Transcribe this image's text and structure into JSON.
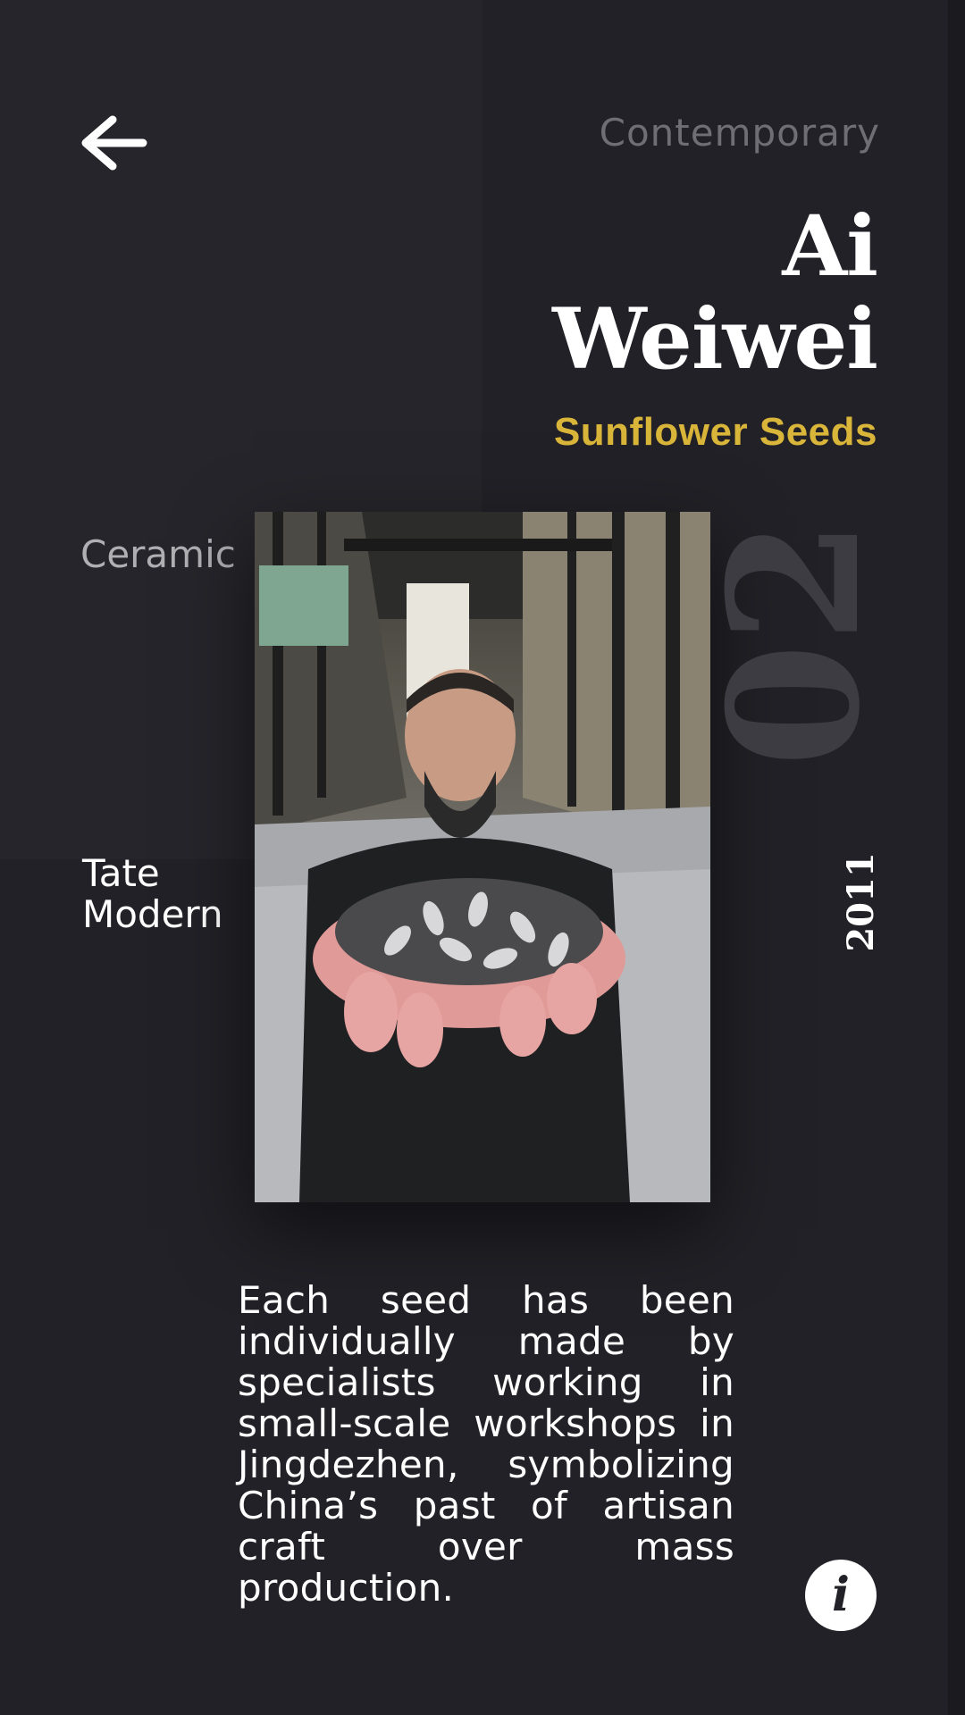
{
  "header": {
    "back_icon": "arrow-left-icon",
    "category": "Contemporary"
  },
  "artwork": {
    "artist_first": "Ai",
    "artist_last": "Weiwei",
    "title": "Sunflower Seeds",
    "medium": "Ceramic",
    "location_line1": "Tate",
    "location_line2": "Modern",
    "number": "02",
    "year": "2011",
    "description": "Each seed has been individually made by specialists working in small-scale workshops in Jingdezhen, symbolizing China’s past of artisan craft over mass production."
  },
  "info_button": {
    "icon": "info-icon",
    "glyph": "i"
  },
  "colors": {
    "background": "#222127",
    "accent": "#d9b53a",
    "muted_text": "#6f6e74",
    "number_text": "#3d3c42"
  }
}
